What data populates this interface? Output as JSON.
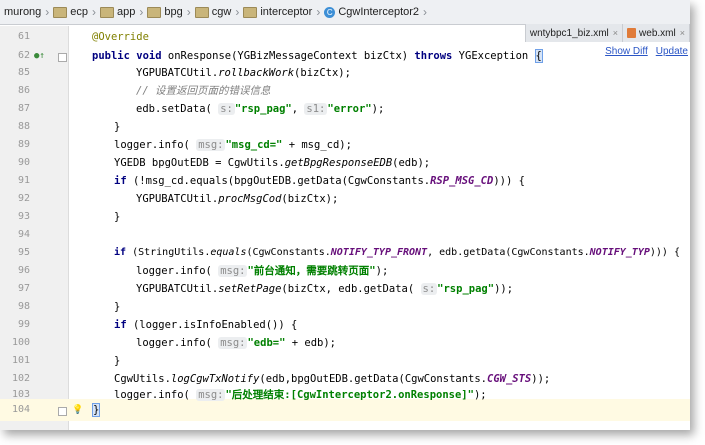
{
  "breadcrumb": [
    {
      "label": "murong",
      "icon": "folder-icon"
    },
    {
      "label": "ecp",
      "icon": "folder-icon"
    },
    {
      "label": "app",
      "icon": "folder-icon"
    },
    {
      "label": "bpg",
      "icon": "folder-icon"
    },
    {
      "label": "cgw",
      "icon": "folder-icon"
    },
    {
      "label": "interceptor",
      "icon": "folder-icon"
    },
    {
      "label": "CgwInterceptor2",
      "icon": "class-icon"
    }
  ],
  "tabs": [
    {
      "label": "wntybpc1_biz.xml",
      "close": "×"
    },
    {
      "label": "web.xml",
      "close": "×"
    }
  ],
  "diff_links": {
    "show_diff": "Show Diff",
    "update": "Update"
  },
  "lines": [
    {
      "num": "61"
    },
    {
      "num": "62"
    },
    {
      "num": "85"
    },
    {
      "num": "86"
    },
    {
      "num": "87"
    },
    {
      "num": "88"
    },
    {
      "num": "89"
    },
    {
      "num": "90"
    },
    {
      "num": "91"
    },
    {
      "num": "92"
    },
    {
      "num": "93"
    },
    {
      "num": "94"
    },
    {
      "num": "95"
    },
    {
      "num": "96"
    },
    {
      "num": "97"
    },
    {
      "num": "98"
    },
    {
      "num": "99"
    },
    {
      "num": "100"
    },
    {
      "num": "101"
    },
    {
      "num": "102"
    },
    {
      "num": "103"
    },
    {
      "num": "104"
    }
  ],
  "code": {
    "l61": "@Override",
    "l62_kw1": "public void",
    "l62_a": " onResponse(YGBizMessageContext bizCtx) ",
    "l62_kw2": "throws",
    "l62_b": " YGException ",
    "l62_brace": "{",
    "l85_a": "YGPUBATCUtil.",
    "l85_m": "rollbackWork",
    "l85_b": "(bizCtx);",
    "l86": "// 设置返回页面的错误信息",
    "l87_a": "edb.setData(",
    "l87_h1": "s:",
    "l87_s1": "\"rsp_pag\"",
    "l87_b": ", ",
    "l87_h2": "s1:",
    "l87_s2": "\"error\"",
    "l87_c": ");",
    "l88": "}",
    "l89_a": "logger.info(",
    "l89_h": "msg:",
    "l89_s": "\"msg_cd=\"",
    "l89_b": " + msg_cd);",
    "l90_a": "YGEDB bpgOutEDB = CgwUtils.",
    "l90_m": "getBpgResponseEDB",
    "l90_b": "(edb);",
    "l91_kw": "if",
    "l91_a": " (!msg_cd.equals(bpgOutEDB.getData(CgwConstants.",
    "l91_c": "RSP_MSG_CD",
    "l91_b": "))) {",
    "l92_a": "YGPUBATCUtil.",
    "l92_m": "procMsgCod",
    "l92_b": "(bizCtx);",
    "l93": "}",
    "l95_kw": "if",
    "l95_a": " (StringUtils.",
    "l95_m": "equals",
    "l95_b": "(CgwConstants.",
    "l95_c1": "NOTIFY_TYP_FRONT",
    "l95_d": ", edb.getData(CgwConstants.",
    "l95_c2": "NOTIFY_TYP",
    "l95_e": "))) {",
    "l96_a": "logger.info(",
    "l96_h": "msg:",
    "l96_s": "\"前台通知，需要跳转页面\"",
    "l96_b": ");",
    "l97_a": "YGPUBATCUtil.",
    "l97_m": "setRetPage",
    "l97_b": "(bizCtx, edb.getData(",
    "l97_h": "s:",
    "l97_s": "\"rsp_pag\"",
    "l97_c": "));",
    "l98": "}",
    "l99_kw": "if",
    "l99_a": " (logger.isInfoEnabled()) {",
    "l100_a": "logger.info(",
    "l100_h": "msg:",
    "l100_s": "\"edb=\"",
    "l100_b": " + edb);",
    "l101": "}",
    "l102_a": "CgwUtils.",
    "l102_m": "logCgwTxNotify",
    "l102_b": "(edb,bpgOutEDB.getData(CgwConstants.",
    "l102_c": "CGW_STS",
    "l102_d": "));",
    "l103_a": "logger.info(",
    "l103_h": "msg:",
    "l103_s": "\"后处理结束:[CgwInterceptor2.onResponse]\"",
    "l103_b": ");",
    "l104": "}"
  },
  "colors": {
    "keyword": "#000080",
    "string": "#008000",
    "constant": "#660e7a",
    "annotation": "#808000",
    "comment": "#808080",
    "link": "#2a55c5"
  },
  "gutter_icons": {
    "l62": "override-icon",
    "l104": "bulb-icon"
  }
}
